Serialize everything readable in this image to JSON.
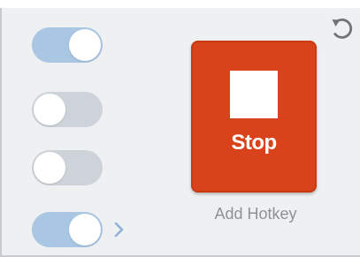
{
  "panel": {
    "toggles": [
      {
        "state": "on"
      },
      {
        "state": "off"
      },
      {
        "state": "off"
      },
      {
        "state": "on",
        "has_submenu": true
      }
    ],
    "reset_icon": "reset-arrow-icon",
    "chevron_icon": "chevron-right-icon"
  },
  "capture": {
    "stop_label": "Stop",
    "stop_icon": "stop-square-icon",
    "hotkey_label": "Add Hotkey"
  },
  "colors": {
    "panel_background": "#eef0f2",
    "toggle_on": "#a9c6e3",
    "toggle_off": "#cdd3d9",
    "stop_button": "#d9431b",
    "hotkey_text": "#8d9296",
    "icon_gray": "#6f7478",
    "chevron_blue": "#8fb3d7"
  }
}
